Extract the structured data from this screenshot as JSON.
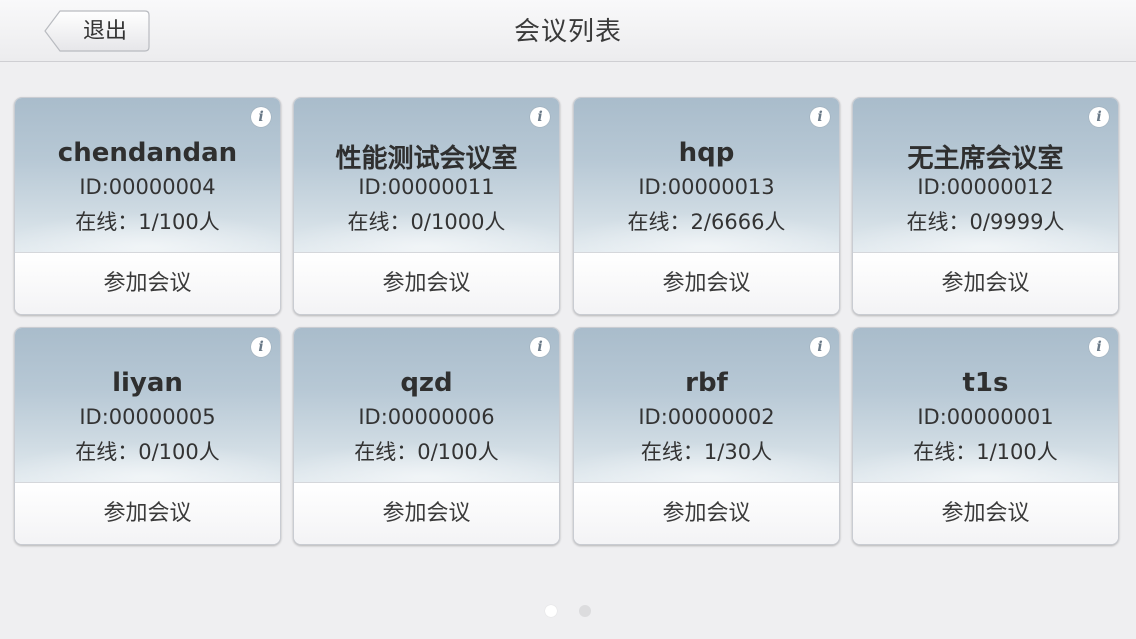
{
  "navbar": {
    "title": "会议列表",
    "back_label": "退出"
  },
  "rooms": [
    {
      "name": "chendandan",
      "id": "ID:00000004",
      "online": "在线：1/100人",
      "join_label": "参加会议"
    },
    {
      "name": "性能测试会议室",
      "id": "ID:00000011",
      "online": "在线：0/1000人",
      "join_label": "参加会议"
    },
    {
      "name": "hqp",
      "id": "ID:00000013",
      "online": "在线：2/6666人",
      "join_label": "参加会议"
    },
    {
      "name": "无主席会议室",
      "id": "ID:00000012",
      "online": "在线：0/9999人",
      "join_label": "参加会议"
    },
    {
      "name": "liyan",
      "id": "ID:00000005",
      "online": "在线：0/100人",
      "join_label": "参加会议"
    },
    {
      "name": "qzd",
      "id": "ID:00000006",
      "online": "在线：0/100人",
      "join_label": "参加会议"
    },
    {
      "name": "rbf",
      "id": "ID:00000002",
      "online": "在线：1/30人",
      "join_label": "参加会议"
    },
    {
      "name": "t1s",
      "id": "ID:00000001",
      "online": "在线：1/100人",
      "join_label": "参加会议"
    }
  ],
  "info_icon": {
    "symbol": "i",
    "name": "info-icon"
  },
  "pager": {
    "page": 1,
    "pages": 2
  }
}
